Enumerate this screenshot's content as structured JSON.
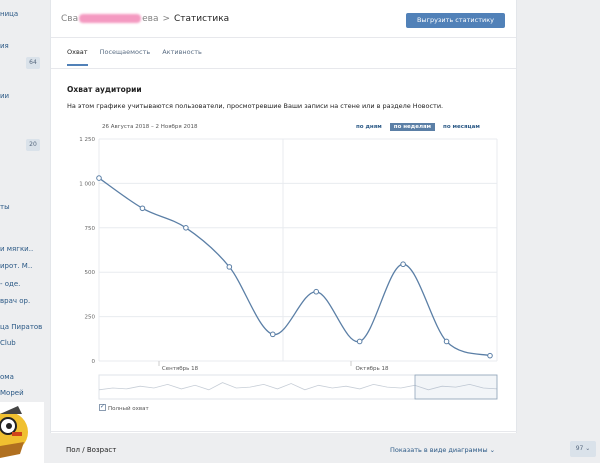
{
  "sidebar": {
    "items": [
      {
        "label": "ница"
      },
      {
        "label": "ия"
      },
      {
        "label": "ии"
      },
      {
        "label": "ты"
      },
      {
        "label": "и мягки.."
      },
      {
        "label": "ирот. М.."
      },
      {
        "label": "- оде."
      },
      {
        "label": "врач ор."
      },
      {
        "label": "ца Пиратов"
      },
      {
        "label": "Club"
      },
      {
        "label": "ома"
      },
      {
        "label": "Морей"
      }
    ],
    "badges": [
      "64",
      "20"
    ]
  },
  "header": {
    "crumb_start": "Сва",
    "crumb_end": "ева",
    "separator": ">",
    "title": "Статистика",
    "export_label": "Выгрузить статистику"
  },
  "tabs": [
    {
      "label": "Охват"
    },
    {
      "label": "Посещаемость"
    },
    {
      "label": "Активность"
    }
  ],
  "section": {
    "title": "Охват аудитории",
    "description": "На этом графике учитываются пользователи, просмотревшие Ваши записи на стене или в разделе Новости."
  },
  "chart_controls": {
    "date_range": "26 Августа 2018 – 2 Ноября 2018",
    "periods": [
      "по дням",
      "по неделям",
      "по месяцам"
    ],
    "active_period": "по неделям"
  },
  "chart_data": {
    "type": "line",
    "title": "",
    "xlabel": "",
    "ylabel": "",
    "y_ticks": [
      "0",
      "250",
      "500",
      "750",
      "1 000",
      "1 250"
    ],
    "x_labels": [
      "Сентябрь 18",
      "Октябрь 18"
    ],
    "ylim": [
      0,
      1250
    ],
    "grid": true,
    "series": [
      {
        "name": "Полный охват",
        "color": "#5b7fa6",
        "values": [
          1030,
          860,
          750,
          530,
          150,
          390,
          110,
          545,
          110,
          30
        ]
      }
    ]
  },
  "legend": {
    "label": "Полный охват"
  },
  "footer": {
    "title": "Пол / Возраст",
    "link": "Показать в виде диаграммы"
  },
  "bottom_badge": "97"
}
